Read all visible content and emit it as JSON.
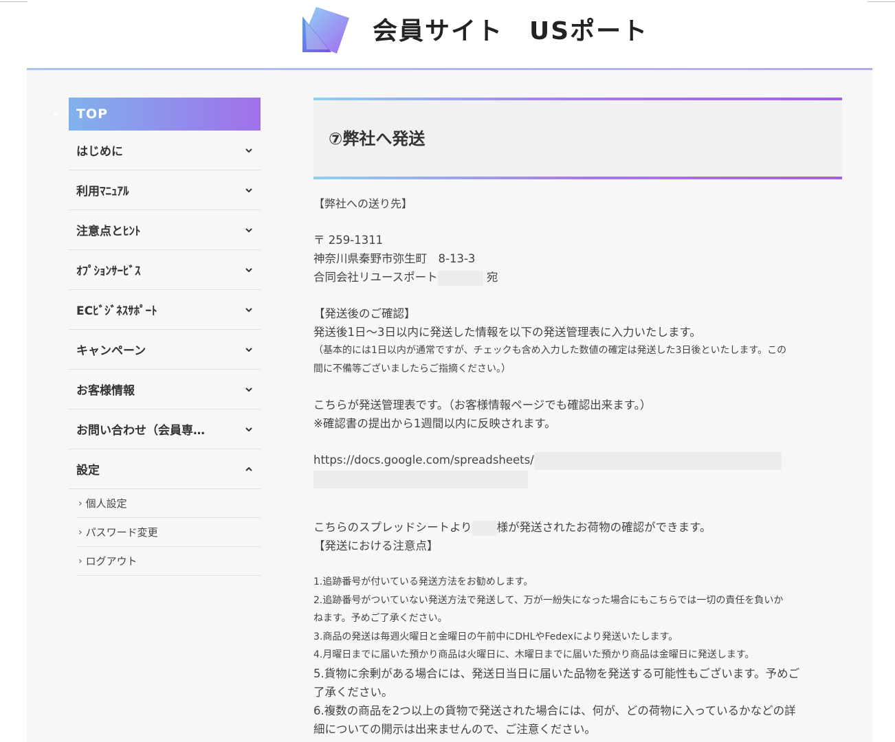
{
  "header": {
    "site_title": "会員サイト　USポート"
  },
  "sidebar": {
    "top_label": "TOP",
    "items": [
      {
        "label": "はじめに"
      },
      {
        "label": "利用ﾏﾆｭｱﾙ"
      },
      {
        "label": "注意点とﾋﾝﾄ"
      },
      {
        "label": "ｵﾌﾟｼｮﾝｻｰﾋﾞｽ"
      },
      {
        "label": "ECﾋﾞｼﾞﾈｽｻﾎﾟｰﾄ"
      },
      {
        "label": "キャンペーン"
      },
      {
        "label": "お客様情報"
      },
      {
        "label": "お問い合わせ（会員専…"
      },
      {
        "label": "設定"
      }
    ],
    "sub_items": [
      {
        "label": "個人設定"
      },
      {
        "label": "パスワード変更"
      },
      {
        "label": "ログアウト"
      }
    ]
  },
  "main": {
    "title": "⑦弊社へ発送",
    "send_to_heading": "【弊社への送り先】",
    "postal_code": "〒 259-1311",
    "address": "神奈川県秦野市弥生町　8-13-3",
    "company": "合同会社リユースポート",
    "company_suffix": "宛",
    "confirm_heading": "【発送後のご確認】",
    "confirm_text": "発送後1日～3日以内に発送した情報を以下の発送管理表に入力いたします。",
    "confirm_note_1": "（基本的には1日以内が通常ですが、チェックも含め入力した数値の確定は発送した3日後といたします。この",
    "confirm_note_2": "間に不備等ございましたらご指摘ください。）",
    "sheet_text": "こちらが発送管理表です。（お客様情報ページでも確認出来ます。）",
    "sheet_note": "※確認書の提出から1週間以内に反映されます。",
    "url_visible": "https://docs.google.com/spreadsheets/",
    "spreadsheet_text_pre": "こちらのスプレッドシートより",
    "spreadsheet_text_post": "様が発送されたお荷物の確認ができます。",
    "notes_heading": "【発送における注意点】",
    "notes": [
      "1.追跡番号が付いている発送方法をお勧めします。",
      "2.追跡番号がついていない発送方法で発送して、万が一紛失になった場合にもこちらでは一切の責任を負いか",
      "ねます。予めご了承ください。",
      "3.商品の発送は毎週火曜日と金曜日の午前中にDHLやFedexにより発送いたします。",
      "4.月曜日までに届いた預かり商品は火曜日に、木曜日までに届いた預かり商品は金曜日に発送します。"
    ],
    "notes_large": [
      "5.貨物に余剰がある場合には、発送日当日に届いた品物を発送する可能性もございます。予めご",
      "了承ください。",
      "6.複数の商品を2つ以上の貨物で発送された場合には、何が、どの荷物に入っているかなどの詳",
      "細についての開示は出来ませんので、ご注意ください。"
    ]
  },
  "colors": {
    "accent_start": "#7fb2ec",
    "accent_end": "#a070ea"
  }
}
